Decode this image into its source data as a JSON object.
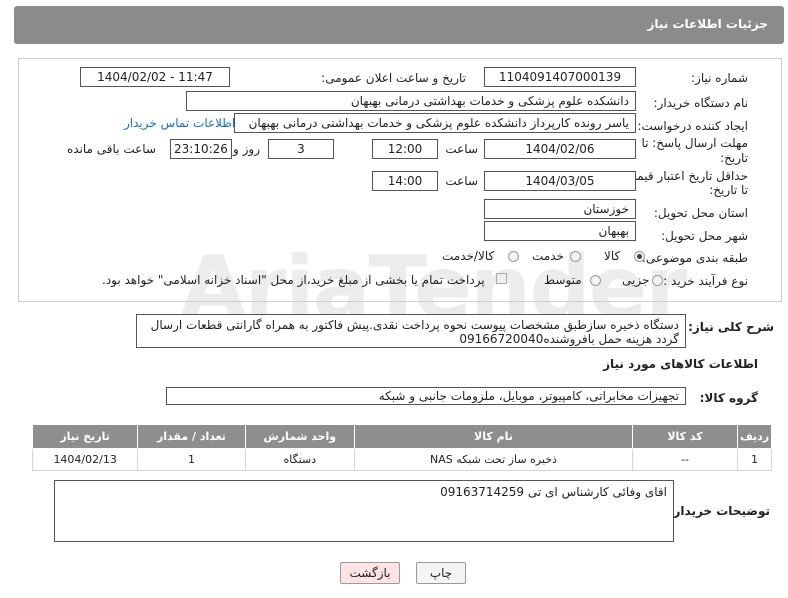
{
  "header": {
    "title": "جزئیات اطلاعات نیاز"
  },
  "form": {
    "need_number_label": "شماره نیاز:",
    "need_number": "1104091407000139",
    "announce_label": "تاریخ و ساعت اعلان عمومی:",
    "announce_value": "1404/02/02 - 11:47",
    "buyer_label": "نام دستگاه خریدار:",
    "buyer_value": "دانشکده علوم پزشکی و خدمات بهداشتی  درمانی بهبهان",
    "creator_label": "ایجاد کننده درخواست:",
    "creator_value": "یاسر رونده کارپرداز دانشکده علوم پزشکی و خدمات بهداشتی  درمانی بهبهان",
    "contact_link": "اطلاعات تماس خریدار",
    "reply_label_1": "مهلت ارسال پاسخ: تا",
    "reply_label_2": "تاریخ:",
    "reply_date": "1404/02/06",
    "time_label": "ساعت",
    "reply_time": "12:00",
    "days_value": "3",
    "days_label": "روز و",
    "remaining_time": "23:10:26",
    "remaining_label": "ساعت باقی مانده",
    "price_label_1": "حداقل تاریخ اعتبار قیمت:",
    "price_label_2": "تا تاریخ:",
    "price_date": "1404/03/05",
    "price_time": "14:00",
    "province_label": "استان محل تحویل:",
    "province_value": "خوزستان",
    "city_label": "شهر محل تحویل:",
    "city_value": "بهبهان",
    "category_label": "طبقه بندی موضوعی:",
    "category_options": [
      "کالا",
      "خدمت",
      "کالا/خدمت"
    ],
    "purchase_label": "نوع فرآیند خرید :",
    "purchase_options": [
      "جزیی",
      "متوسط"
    ],
    "payment_text": "پرداخت تمام یا بخشی از مبلغ خرید،از محل \"اسناد خزانه اسلامی\" خواهد بود."
  },
  "description": {
    "label": "شرح کلی نیاز:",
    "text": "دستگاه ذخیره سازطبق مشخصات پیوست نحوه پرداخت نقدی.پیش فاکتور به همراه گارانتی قطعات ارسال گردد هزینه حمل بافروشنده09166720040"
  },
  "goods": {
    "section_title": "اطلاعات کالاهای مورد نیاز",
    "group_label": "گروه کالا:",
    "group_value": "تجهیزات مخابراتی، کامپیوتر، موبایل، ملزومات جانبی و شبکه",
    "columns": [
      "ردیف",
      "کد کالا",
      "نام کالا",
      "واحد شمارش",
      "تعداد / مقدار",
      "تاریخ نیاز"
    ],
    "rows": [
      [
        "1",
        "--",
        "ذخیره ساز تحت شبکه NAS",
        "دستگاه",
        "1",
        "1404/02/13"
      ]
    ]
  },
  "buyer_notes": {
    "label": "توضیحات خریدار:",
    "text": "اقای وفائی کارشناس ای تی 09163714259"
  },
  "buttons": {
    "print": "چاپ",
    "back": "بازگشت"
  },
  "colors": {
    "header_bg": "#8b8b8b",
    "link": "#1a6fc9",
    "back_button_bg": "#fde3e3"
  }
}
